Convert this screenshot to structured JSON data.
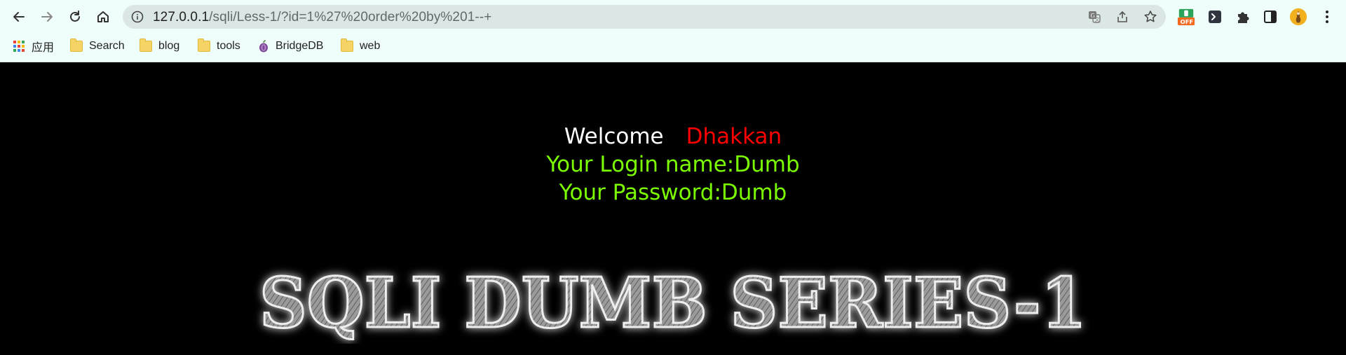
{
  "browser": {
    "url_host": "127.0.0.1",
    "url_path": "/sqli/Less-1/?id=1%27%20order%20by%201--+",
    "icons": {
      "back": "arrow-left-icon",
      "forward": "arrow-right-icon",
      "reload": "reload-icon",
      "home": "home-icon",
      "site_info": "info-icon",
      "translate": "translate-icon",
      "share": "share-icon",
      "bookmark_star": "star-icon",
      "extension_off_badge": "OFF",
      "terminal_extension": "terminal-icon",
      "extensions": "puzzle-icon",
      "side_panel": "side-panel-icon",
      "profile": "avatar",
      "menu": "kebab-menu-icon"
    }
  },
  "bookmarks": [
    {
      "label": "应用",
      "icon": "apps-grid-icon"
    },
    {
      "label": "Search",
      "icon": "folder-icon"
    },
    {
      "label": "blog",
      "icon": "folder-icon"
    },
    {
      "label": "tools",
      "icon": "folder-icon"
    },
    {
      "label": "BridgeDB",
      "icon": "onion-icon"
    },
    {
      "label": "web",
      "icon": "folder-icon"
    }
  ],
  "page": {
    "welcome_label": "Welcome",
    "welcome_name": "Dhakkan",
    "login_line": "Your Login name:Dumb",
    "password_line": "Your Password:Dumb",
    "banner_text": "SQLI DUMB SERIES-1",
    "colors": {
      "background": "#000000",
      "welcome": "#ffffff",
      "name": "#ff0000",
      "credentials": "#7cfc00"
    }
  }
}
